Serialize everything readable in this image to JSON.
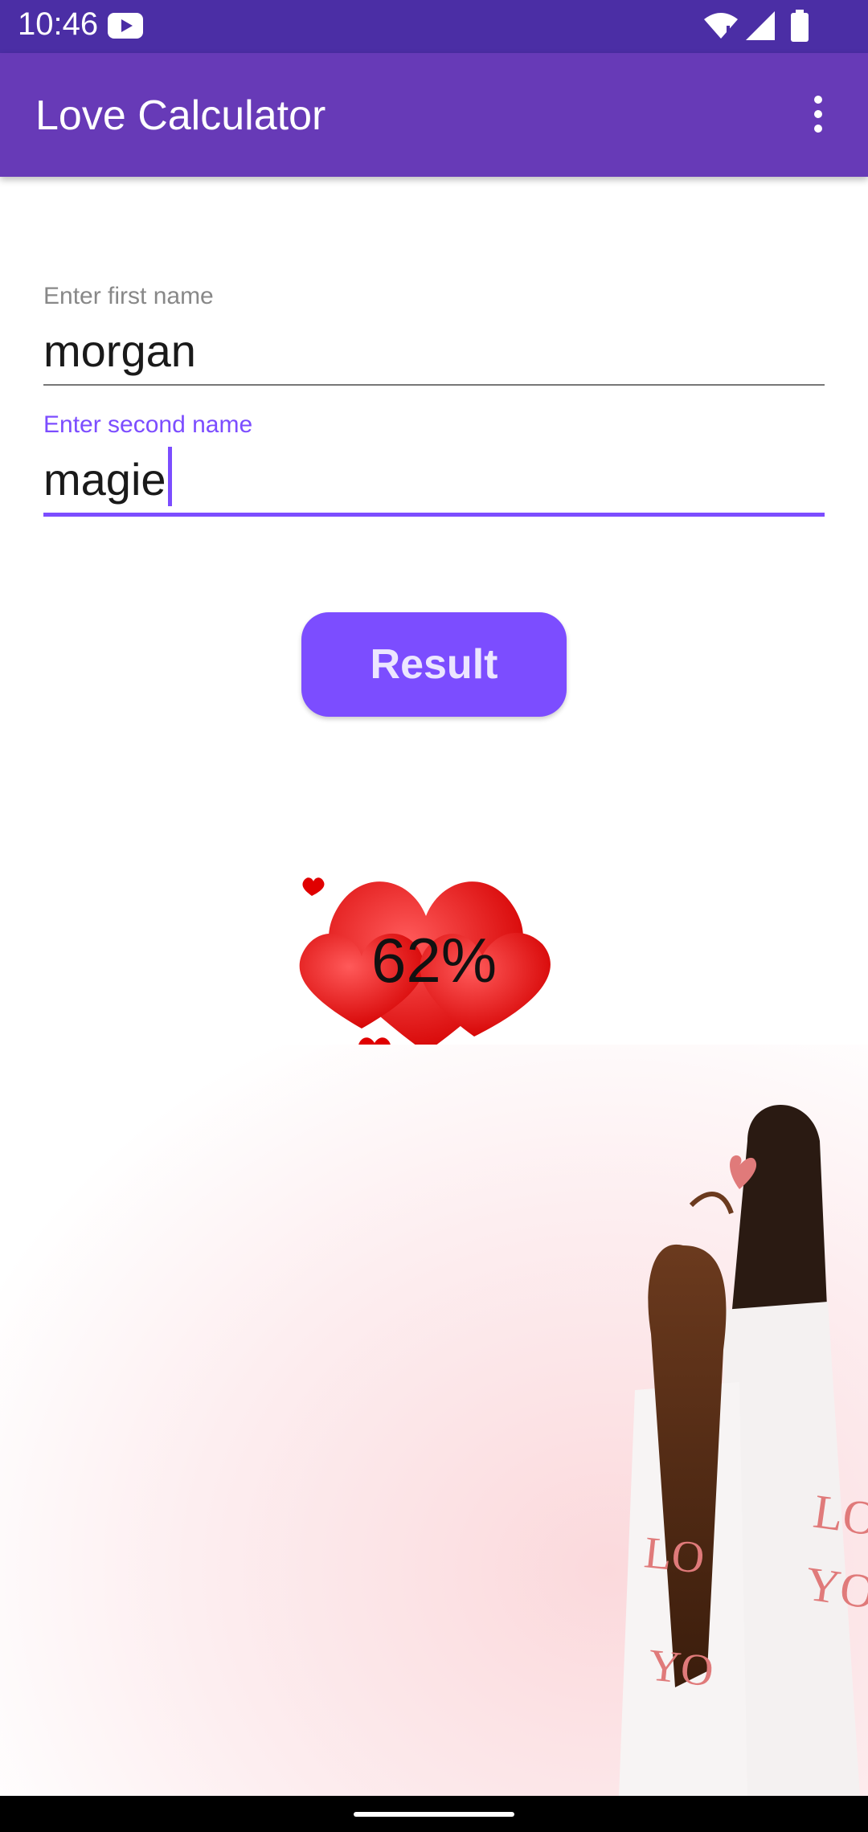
{
  "status_bar": {
    "time": "10:46"
  },
  "app_bar": {
    "title": "Love Calculator"
  },
  "form": {
    "first_name": {
      "label": "Enter first name",
      "value": "morgan"
    },
    "second_name": {
      "label": "Enter second name",
      "value": "magie"
    }
  },
  "result_button": {
    "label": "Result"
  },
  "result": {
    "percentage": "62%"
  },
  "illustration": {
    "shirt_text": "LOVE YOU"
  },
  "colors": {
    "primary_dark": "#4b2ea5",
    "primary": "#673ab7",
    "accent": "#7c4dff",
    "heart": "#ff1a1a"
  }
}
